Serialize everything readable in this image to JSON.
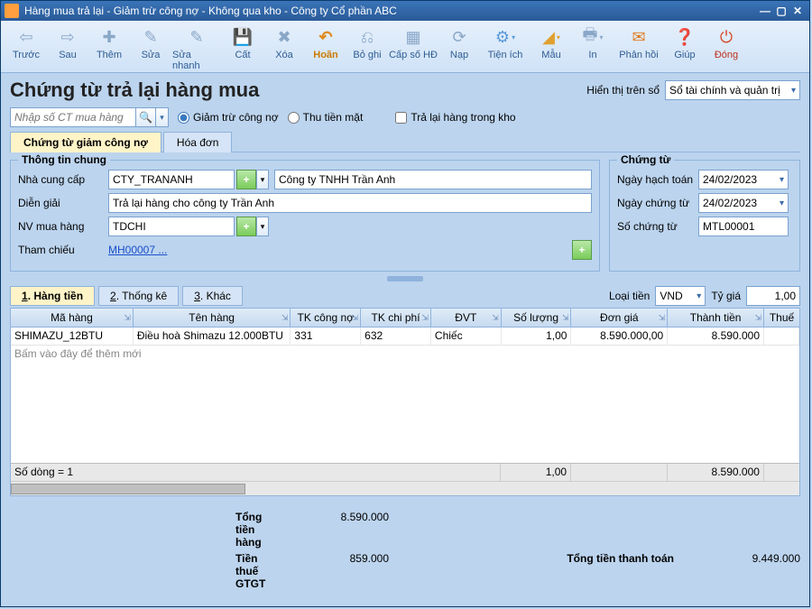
{
  "titlebar": {
    "title": "Hàng mua trả lại - Giảm trừ công nợ - Không qua kho - Công ty Cổ phần ABC"
  },
  "toolbar": {
    "items": [
      "Trước",
      "Sau",
      "Thêm",
      "Sửa",
      "Sửa nhanh",
      "Cất",
      "Xóa",
      "Hoãn",
      "Bỏ ghi",
      "Cấp số HĐ",
      "Nạp",
      "Tiện ích",
      "Mẫu",
      "In",
      "Phản hồi",
      "Giúp",
      "Đóng"
    ]
  },
  "header": {
    "title": "Chứng từ trả lại hàng mua",
    "display_label": "Hiển thị trên sổ",
    "display_value": "Sổ tài chính và quản trị"
  },
  "search": {
    "placeholder": "Nhập số CT mua hàng",
    "radio1": "Giảm trừ công nợ",
    "radio2": "Thu tiền mặt",
    "check1": "Trả lại hàng trong kho"
  },
  "tabs": {
    "t1": "Chứng từ giảm công nợ",
    "t2": "Hóa đơn"
  },
  "general": {
    "legend": "Thông tin chung",
    "supplier_label": "Nhà cung cấp",
    "supplier_code": "CTY_TRANANH",
    "supplier_name": "Công ty TNHH Trần Anh",
    "desc_label": "Diễn giải",
    "desc_value": "Trả lại hàng cho công ty Trần Anh",
    "buyer_label": "NV mua hàng",
    "buyer_value": "TDCHI",
    "ref_label": "Tham chiếu",
    "ref_value": "MH00007 ..."
  },
  "voucher": {
    "legend": "Chứng từ",
    "acc_date_label": "Ngày hạch toán",
    "acc_date": "24/02/2023",
    "doc_date_label": "Ngày chứng từ",
    "doc_date": "24/02/2023",
    "num_label": "Số chứng từ",
    "num": "MTL00001"
  },
  "subtabs": {
    "s1": "Hàng tiền",
    "s2": "Thống kê",
    "s3": "Khác",
    "p1": "1",
    "p2": "2",
    "p3": "3"
  },
  "currency": {
    "label": "Loại tiền",
    "value": "VND",
    "rate_label": "Tỷ giá",
    "rate": "1,00"
  },
  "grid": {
    "headers": {
      "ma": "Mã hàng",
      "ten": "Tên hàng",
      "tkcn": "TK công nợ",
      "tkcp": "TK chi phí",
      "dvt": "ĐVT",
      "sl": "Số lượng",
      "dg": "Đơn giá",
      "tt": "Thành tiền",
      "thue": "Thuế"
    },
    "rows": [
      {
        "ma": "SHIMAZU_12BTU",
        "ten": "Điều hoà Shimazu 12.000BTU",
        "tkcn": "331",
        "tkcp": "632",
        "dvt": "Chiếc",
        "sl": "1,00",
        "dg": "8.590.000,00",
        "tt": "8.590.000"
      }
    ],
    "add_row": "Bấm vào đây để thêm mới",
    "summary": {
      "label": "Số dòng = 1",
      "sl": "1,00",
      "tt": "8.590.000"
    }
  },
  "totals": {
    "goods_label": "Tổng tiền hàng",
    "goods": "8.590.000",
    "vat_label": "Tiền thuế GTGT",
    "vat": "859.000",
    "pay_label": "Tổng tiền thanh toán",
    "pay": "9.449.000"
  }
}
